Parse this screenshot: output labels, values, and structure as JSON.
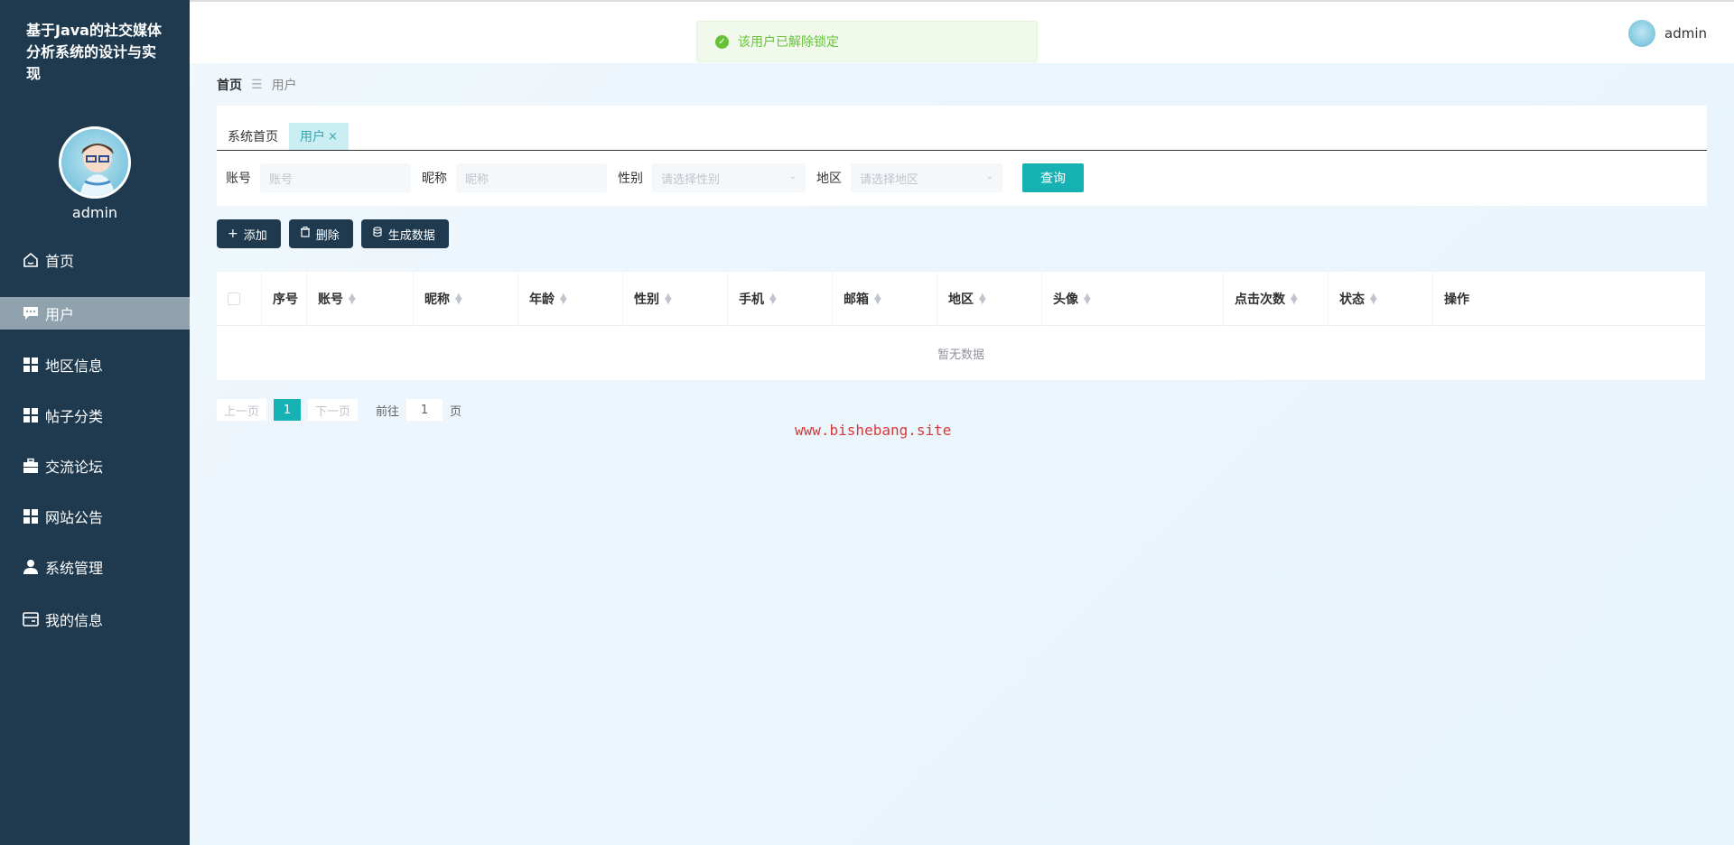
{
  "sidebar": {
    "title": "基于Java的社交媒体分析系统的设计与实现",
    "username": "admin",
    "items": [
      {
        "label": "首页",
        "icon": "home-icon"
      },
      {
        "label": "用户",
        "icon": "chat-icon"
      },
      {
        "label": "地区信息",
        "icon": "grid-icon"
      },
      {
        "label": "帖子分类",
        "icon": "grid-icon"
      },
      {
        "label": "交流论坛",
        "icon": "briefcase-icon"
      },
      {
        "label": "网站公告",
        "icon": "grid-icon"
      },
      {
        "label": "系统管理",
        "icon": "person-icon"
      },
      {
        "label": "我的信息",
        "icon": "card-icon"
      }
    ],
    "active_index": 1,
    "bg_color": "#1f3a4e"
  },
  "topbar": {
    "username": "admin"
  },
  "toast": {
    "message": "该用户已解除锁定",
    "type": "success"
  },
  "breadcrumb": {
    "home": "首页",
    "current": "用户"
  },
  "tabs": [
    {
      "label": "系统首页"
    },
    {
      "label": "用户",
      "closable": "×"
    }
  ],
  "search": {
    "account_label": "账号",
    "account_placeholder": "账号",
    "nickname_label": "昵称",
    "nickname_placeholder": "昵称",
    "gender_label": "性别",
    "gender_placeholder": "请选择性别",
    "region_label": "地区",
    "region_placeholder": "请选择地区",
    "query_label": "查询"
  },
  "actions": {
    "add": "添加",
    "delete": "删除",
    "generate": "生成数据"
  },
  "table": {
    "columns": [
      "序号",
      "账号",
      "昵称",
      "年龄",
      "性别",
      "手机",
      "邮箱",
      "地区",
      "头像",
      "点击次数",
      "状态",
      "操作"
    ],
    "empty_text": "暂无数据"
  },
  "pager": {
    "prev": "上一页",
    "current": "1",
    "next": "下一页",
    "goto": "前往",
    "page_input": "1",
    "page_unit": "页"
  },
  "watermark": "www.bishebang.site",
  "accent_color": "#16b2b3"
}
